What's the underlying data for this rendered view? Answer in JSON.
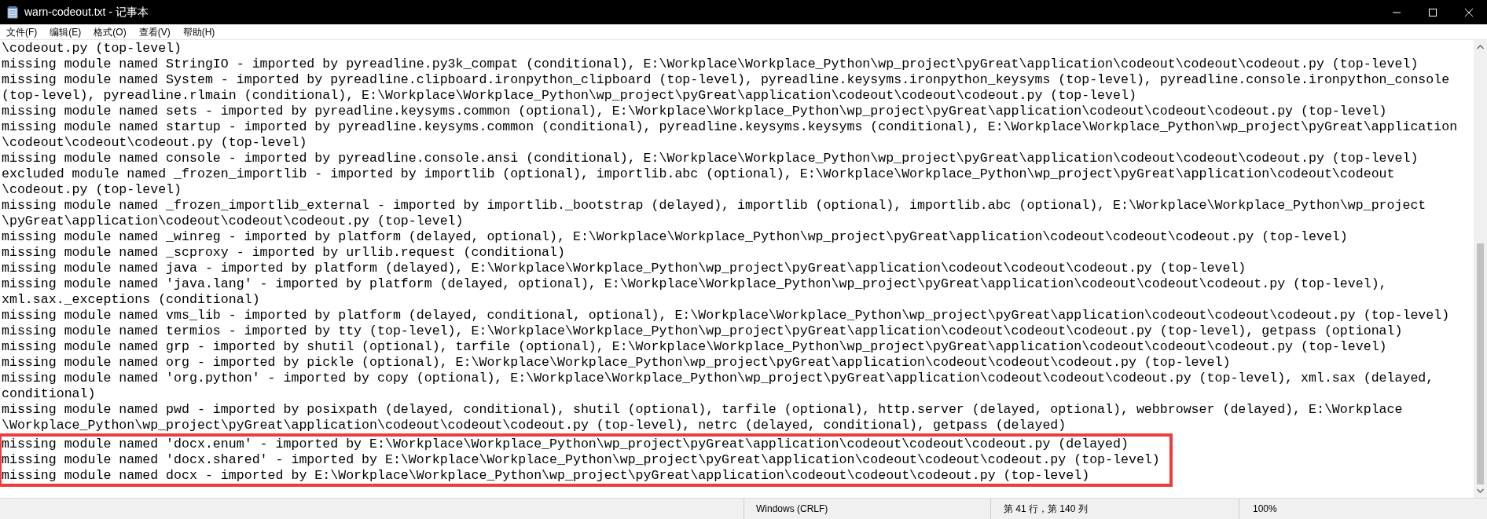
{
  "window": {
    "title": "warn-codeout.txt - 记事本"
  },
  "menu": [
    "文件(F)",
    "编辑(E)",
    "格式(O)",
    "查看(V)",
    "帮助(H)"
  ],
  "lines": [
    {
      "text": "\\codeout.py (top-level)",
      "highlighted": false
    },
    {
      "text": "missing module named StringIO - imported by pyreadline.py3k_compat (conditional), E:\\Workplace\\Workplace_Python\\wp_project\\pyGreat\\application\\codeout\\codeout\\codeout.py (top-level)",
      "highlighted": false
    },
    {
      "text": "missing module named System - imported by pyreadline.clipboard.ironpython_clipboard (top-level), pyreadline.keysyms.ironpython_keysyms (top-level), pyreadline.console.ironpython_console",
      "highlighted": false
    },
    {
      "text": "(top-level), pyreadline.rlmain (conditional), E:\\Workplace\\Workplace_Python\\wp_project\\pyGreat\\application\\codeout\\codeout\\codeout.py (top-level)",
      "highlighted": false
    },
    {
      "text": "missing module named sets - imported by pyreadline.keysyms.common (optional), E:\\Workplace\\Workplace_Python\\wp_project\\pyGreat\\application\\codeout\\codeout\\codeout.py (top-level)",
      "highlighted": false
    },
    {
      "text": "missing module named startup - imported by pyreadline.keysyms.common (conditional), pyreadline.keysyms.keysyms (conditional), E:\\Workplace\\Workplace_Python\\wp_project\\pyGreat\\application",
      "highlighted": false
    },
    {
      "text": "\\codeout\\codeout\\codeout.py (top-level)",
      "highlighted": false
    },
    {
      "text": "missing module named console - imported by pyreadline.console.ansi (conditional), E:\\Workplace\\Workplace_Python\\wp_project\\pyGreat\\application\\codeout\\codeout\\codeout.py (top-level)",
      "highlighted": false
    },
    {
      "text": "excluded module named _frozen_importlib - imported by importlib (optional), importlib.abc (optional), E:\\Workplace\\Workplace_Python\\wp_project\\pyGreat\\application\\codeout\\codeout",
      "highlighted": false
    },
    {
      "text": "\\codeout.py (top-level)",
      "highlighted": false
    },
    {
      "text": "missing module named _frozen_importlib_external - imported by importlib._bootstrap (delayed), importlib (optional), importlib.abc (optional), E:\\Workplace\\Workplace_Python\\wp_project",
      "highlighted": false
    },
    {
      "text": "\\pyGreat\\application\\codeout\\codeout\\codeout.py (top-level)",
      "highlighted": false
    },
    {
      "text": "missing module named _winreg - imported by platform (delayed, optional), E:\\Workplace\\Workplace_Python\\wp_project\\pyGreat\\application\\codeout\\codeout\\codeout.py (top-level)",
      "highlighted": false
    },
    {
      "text": "missing module named _scproxy - imported by urllib.request (conditional)",
      "highlighted": false
    },
    {
      "text": "missing module named java - imported by platform (delayed), E:\\Workplace\\Workplace_Python\\wp_project\\pyGreat\\application\\codeout\\codeout\\codeout.py (top-level)",
      "highlighted": false
    },
    {
      "text": "missing module named 'java.lang' - imported by platform (delayed, optional), E:\\Workplace\\Workplace_Python\\wp_project\\pyGreat\\application\\codeout\\codeout\\codeout.py (top-level),",
      "highlighted": false
    },
    {
      "text": "xml.sax._exceptions (conditional)",
      "highlighted": false
    },
    {
      "text": "missing module named vms_lib - imported by platform (delayed, conditional, optional), E:\\Workplace\\Workplace_Python\\wp_project\\pyGreat\\application\\codeout\\codeout\\codeout.py (top-level)",
      "highlighted": false
    },
    {
      "text": "missing module named termios - imported by tty (top-level), E:\\Workplace\\Workplace_Python\\wp_project\\pyGreat\\application\\codeout\\codeout\\codeout.py (top-level), getpass (optional)",
      "highlighted": false
    },
    {
      "text": "missing module named grp - imported by shutil (optional), tarfile (optional), E:\\Workplace\\Workplace_Python\\wp_project\\pyGreat\\application\\codeout\\codeout\\codeout.py (top-level)",
      "highlighted": false
    },
    {
      "text": "missing module named org - imported by pickle (optional), E:\\Workplace\\Workplace_Python\\wp_project\\pyGreat\\application\\codeout\\codeout\\codeout.py (top-level)",
      "highlighted": false
    },
    {
      "text": "missing module named 'org.python' - imported by copy (optional), E:\\Workplace\\Workplace_Python\\wp_project\\pyGreat\\application\\codeout\\codeout\\codeout.py (top-level), xml.sax (delayed,",
      "highlighted": false
    },
    {
      "text": "conditional)",
      "highlighted": false
    },
    {
      "text": "missing module named pwd - imported by posixpath (delayed, conditional), shutil (optional), tarfile (optional), http.server (delayed, optional), webbrowser (delayed), E:\\Workplace",
      "highlighted": false
    },
    {
      "text": "\\Workplace_Python\\wp_project\\pyGreat\\application\\codeout\\codeout\\codeout.py (top-level), netrc (delayed, conditional), getpass (delayed)",
      "highlighted": false
    },
    {
      "text": "missing module named 'docx.enum' - imported by E:\\Workplace\\Workplace_Python\\wp_project\\pyGreat\\application\\codeout\\codeout\\codeout.py (delayed)",
      "highlighted": true
    },
    {
      "text": "missing module named 'docx.shared' - imported by E:\\Workplace\\Workplace_Python\\wp_project\\pyGreat\\application\\codeout\\codeout\\codeout.py (top-level)",
      "highlighted": true
    },
    {
      "text": "missing module named docx - imported by E:\\Workplace\\Workplace_Python\\wp_project\\pyGreat\\application\\codeout\\codeout\\codeout.py (top-level)",
      "highlighted": true
    }
  ],
  "status_bar": {
    "line_ending": "Windows (CRLF)",
    "position": "第 41 行，第 140 列",
    "zoom": "100%"
  }
}
